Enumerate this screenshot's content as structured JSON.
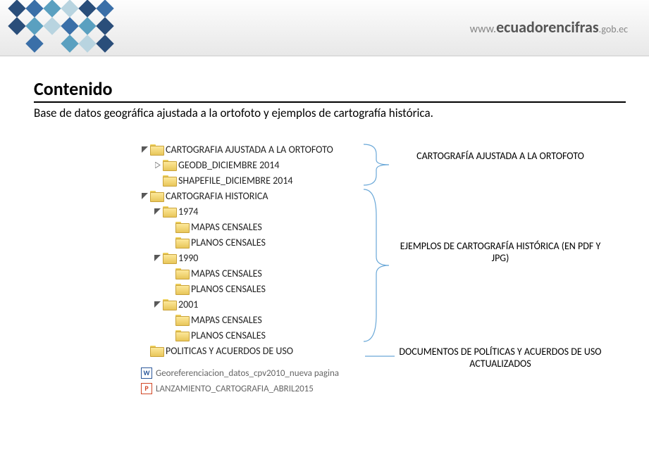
{
  "header": {
    "url_www": "www.",
    "url_domain": "ecuadorencifras",
    "url_tld": ".gob.ec"
  },
  "title": "Contenido",
  "subtitle": "Base de datos geográfica ajustada a la ortofoto y ejemplos de cartografía histórica.",
  "tree": {
    "root1": "CARTOGRAFIA AJUSTADA A LA ORTOFOTO",
    "root1_child1": "GEODB_DICIEMBRE 2014",
    "root1_child2": "SHAPEFILE_DICIEMBRE 2014",
    "root2": "CARTOGRAFIA HISTORICA",
    "y1974": "1974",
    "y1974_m": "MAPAS CENSALES",
    "y1974_p": "PLANOS CENSALES",
    "y1990": "1990",
    "y1990_m": "MAPAS CENSALES",
    "y1990_p": "PLANOS CENSALES",
    "y2001": "2001",
    "y2001_m": "MAPAS CENSALES",
    "y2001_p": "PLANOS CENSALES",
    "root3": "POLITICAS Y ACUERDOS DE USO",
    "file1": "Georeferenciacion_datos_cpv2010_nueva pagina",
    "file2": "LANZAMIENTO_CARTOGRAFIA_ABRIL2015"
  },
  "annotations": {
    "a1": "CARTOGRAFÍA AJUSTADA A LA ORTOFOTO",
    "a2": "EJEMPLOS DE CARTOGRAFÍA HISTÓRICA (EN PDF Y JPG)",
    "a3": "DOCUMENTOS DE POLÍTICAS Y ACUERDOS DE USO ACTUALIZADOS"
  }
}
